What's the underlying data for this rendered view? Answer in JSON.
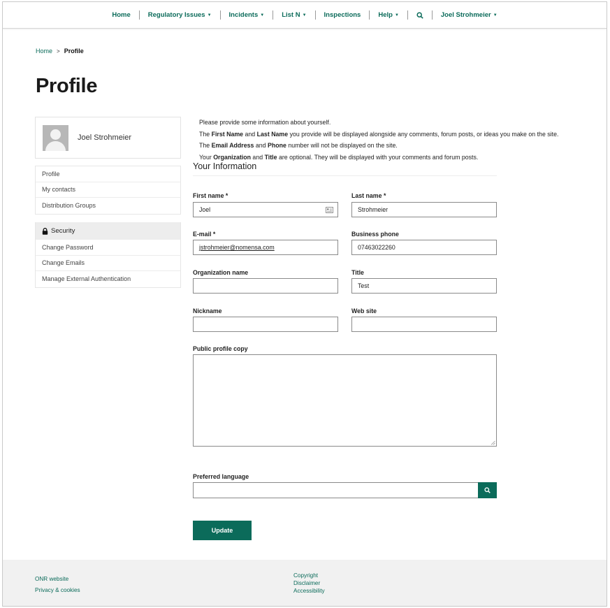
{
  "nav": {
    "items": [
      {
        "label": "Home",
        "dropdown": false
      },
      {
        "label": "Regulatory Issues",
        "dropdown": true
      },
      {
        "label": "Incidents",
        "dropdown": true
      },
      {
        "label": "List N",
        "dropdown": true
      },
      {
        "label": "Inspections",
        "dropdown": false
      },
      {
        "label": "Help",
        "dropdown": true
      }
    ],
    "search_icon": "search-icon",
    "user_label": "Joel Strohmeier"
  },
  "breadcrumb": {
    "home": "Home",
    "separator": ">",
    "current": "Profile"
  },
  "page": {
    "title": "Profile"
  },
  "sidebar": {
    "profile_name": "Joel Strohmeier",
    "items": [
      "Profile",
      "My contacts",
      "Distribution Groups"
    ],
    "security": {
      "heading": "Security",
      "items": [
        "Change Password",
        "Change Emails",
        "Manage External Authentication"
      ]
    }
  },
  "intro": {
    "line1": "Please provide some information about yourself.",
    "line2": {
      "a": "The ",
      "b1": "First Name",
      "c": " and ",
      "b2": "Last Name",
      "d": " you provide will be displayed alongside any comments, forum posts, or ideas you make on the site."
    },
    "line3": {
      "a": "The ",
      "b1": "Email Address",
      "c": " and ",
      "b2": "Phone",
      "d": " number will not be displayed on the site."
    },
    "line4": {
      "a": "Your ",
      "b1": "Organization",
      "c": " and ",
      "b2": "Title",
      "d": " are optional. They will be displayed with your comments and forum posts."
    }
  },
  "form": {
    "section_title": "Your Information",
    "first_name": {
      "label": "First name *",
      "value": "Joel"
    },
    "last_name": {
      "label": "Last name *",
      "value": "Strohmeier"
    },
    "email": {
      "label": "E-mail *",
      "value": "jstrohmeier@nomensa.com"
    },
    "business_phone": {
      "label": "Business phone",
      "value": "07463022260"
    },
    "organization": {
      "label": "Organization name",
      "value": ""
    },
    "title": {
      "label": "Title",
      "value": "Test"
    },
    "nickname": {
      "label": "Nickname",
      "value": ""
    },
    "website": {
      "label": "Web site",
      "value": ""
    },
    "public_profile": {
      "label": "Public profile copy",
      "value": ""
    },
    "preferred_language": {
      "label": "Preferred language",
      "value": ""
    },
    "submit_label": "Update"
  },
  "footer": {
    "left": [
      "ONR website",
      "Privacy & cookies"
    ],
    "center": [
      "Copyright",
      "Disclaimer",
      "Accessibility"
    ]
  },
  "colors": {
    "accent": "#0b6b5a",
    "footer_bg": "#f1f1f1",
    "sidebar_heading_bg": "#ededed"
  }
}
